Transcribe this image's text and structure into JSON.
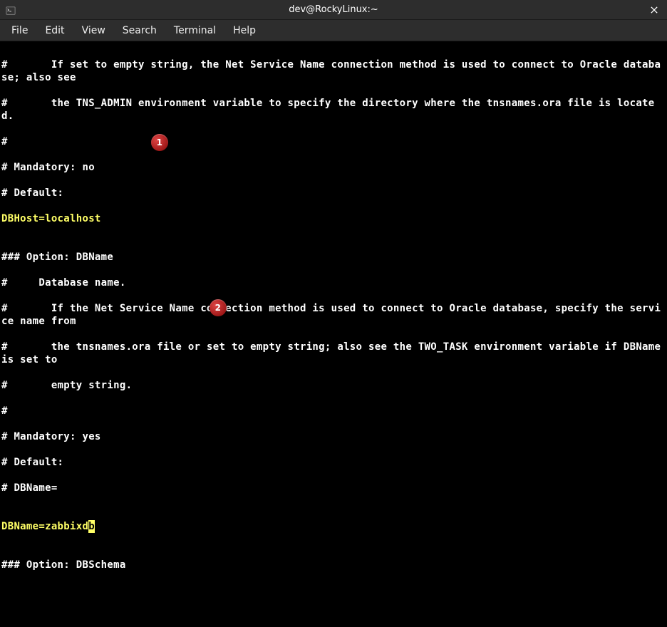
{
  "titlebar": {
    "title": "dev@RockyLinux:~"
  },
  "menubar": {
    "file": "File",
    "edit": "Edit",
    "view": "View",
    "search": "Search",
    "terminal": "Terminal",
    "help": "Help"
  },
  "terminal": {
    "lines": [
      "#       If set to empty string, the Net Service Name connection method is used to connect to Oracle database; also see",
      "#       the TNS_ADMIN environment variable to specify the directory where the tnsnames.ora file is located.",
      "#",
      "# Mandatory: no",
      "# Default:"
    ],
    "highlight1": "DBHost=localhost",
    "lines2": [
      "",
      "### Option: DBName",
      "#     Database name.",
      "#       If the Net Service Name connection method is used to connect to Oracle database, specify the service name from",
      "#       the tnsnames.ora file or set to empty string; also see the TWO_TASK environment variable if DBName is set to",
      "#       empty string.",
      "#",
      "# Mandatory: yes",
      "# Default:",
      "# DBName=",
      ""
    ],
    "highlight2": "DBName=zabbixd",
    "cursor_char": "b",
    "lines3": [
      "",
      "### Option: DBSchema"
    ]
  },
  "markers": {
    "m1": "1",
    "m2": "2"
  }
}
